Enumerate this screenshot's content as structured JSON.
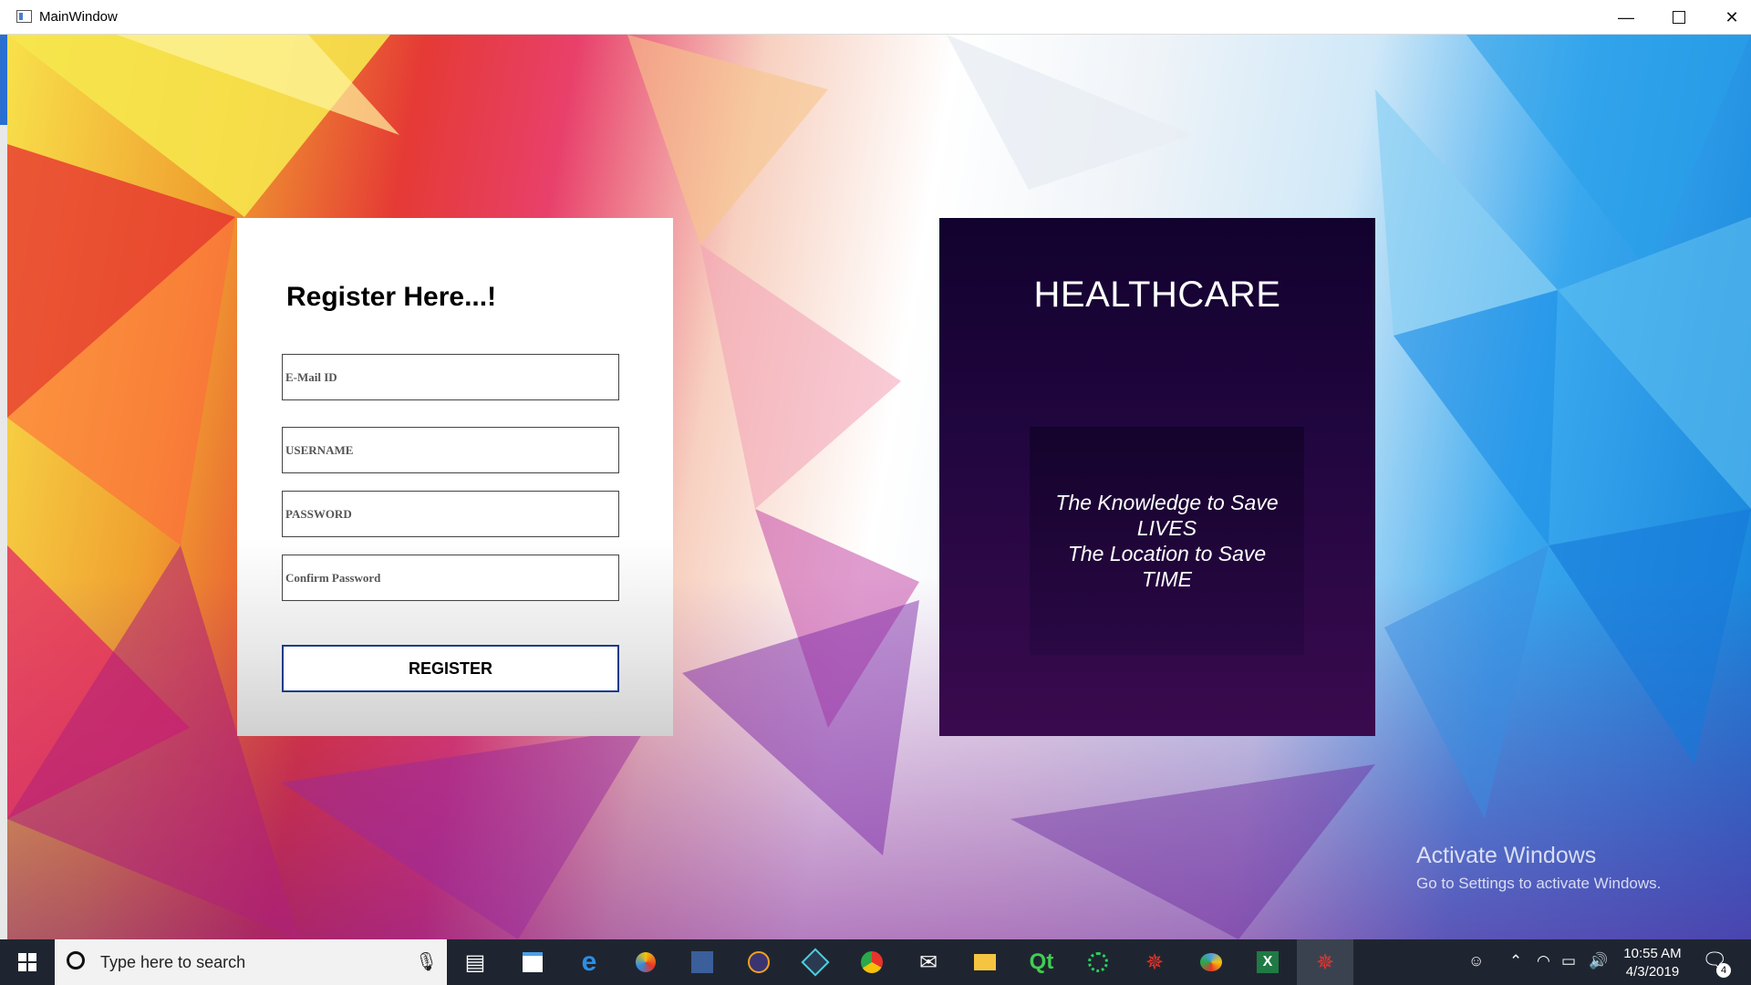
{
  "window": {
    "title": "MainWindow",
    "minimize_icon": "minimize-icon",
    "maximize_icon": "maximize-icon",
    "close_icon": "close-icon"
  },
  "register": {
    "title": "Register Here...!",
    "email_placeholder": "E-Mail ID",
    "username_placeholder": "USERNAME",
    "password_placeholder": "PASSWORD",
    "confirm_placeholder": "Confirm Password",
    "button_label": "REGISTER"
  },
  "brand": {
    "title": "HEALTHCARE",
    "tagline": [
      "The Knowledge to Save",
      "LIVES",
      "The Location to Save",
      "TIME"
    ]
  },
  "watermark": {
    "line1": "Activate Windows",
    "line2": "Go to Settings to activate Windows."
  },
  "taskbar": {
    "search_placeholder": "Type here to search",
    "time": "10:55 AM",
    "date": "4/3/2019",
    "notification_count": "4",
    "apps": [
      "task-view-icon",
      "store-icon",
      "edge-icon",
      "paint-icon",
      "vs-icon",
      "eclipse-icon",
      "media-icon",
      "chrome-icon",
      "mail-icon",
      "file-explorer-icon",
      "qt-icon",
      "sync-icon",
      "web-icon",
      "paint3d-icon",
      "excel-icon",
      "active-app-icon"
    ]
  },
  "colors": {
    "brand_dark": "#12022e",
    "button_border": "#1a3a8a",
    "taskbar": "#1f2530"
  }
}
